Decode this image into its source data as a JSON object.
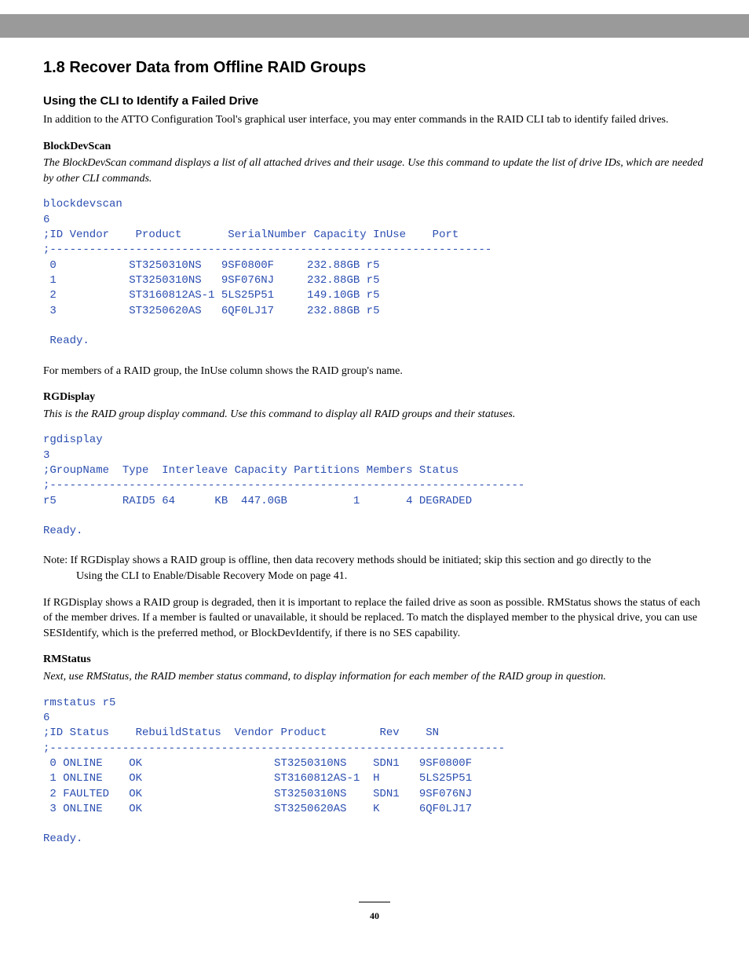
{
  "heading": "1.8 Recover Data from Offline RAID Groups",
  "subheading": "Using the CLI to Identify a Failed Drive",
  "intro": "In addition to the ATTO Configuration Tool's graphical user interface, you may enter commands in the RAID CLI tab to identify failed drives.",
  "blockdevscan": {
    "name": "BlockDevScan",
    "desc": "The BlockDevScan command displays a list of all attached drives and their usage. Use this command to update the list of drive IDs, which are needed by other CLI commands.",
    "cli": "blockdevscan\n6\n;ID Vendor    Product       SerialNumber Capacity InUse    Port\n;-------------------------------------------------------------------\n 0           ST3250310NS   9SF0800F     232.88GB r5\n 1           ST3250310NS   9SF076NJ     232.88GB r5\n 2           ST3160812AS-1 5LS25P51     149.10GB r5\n 3           ST3250620AS   6QF0LJ17     232.88GB r5\n\n Ready."
  },
  "para_after_bds": "For members of a RAID group, the InUse column shows the RAID group's name.",
  "rgdisplay": {
    "name": "RGDisplay",
    "desc": "This is the RAID group display command. Use this command to display all RAID groups and their statuses.",
    "cli": "rgdisplay\n3\n;GroupName  Type  Interleave Capacity Partitions Members Status\n;------------------------------------------------------------------------\nr5          RAID5 64      KB  447.0GB          1       4 DEGRADED\n\nReady."
  },
  "note_line1": "Note: If RGDisplay shows a RAID group is offline, then data recovery methods should be initiated; skip this section and go directly to the",
  "note_line2": "Using the CLI to Enable/Disable Recovery Mode on page 41.",
  "para_after_note": "If RGDisplay shows a RAID group is degraded, then it is important to replace the failed drive as soon as possible. RMStatus shows the status of each of the member drives. If a member is faulted or unavailable, it should be replaced. To match the displayed member to the physical drive, you can use SESIdentify, which is the preferred method, or BlockDevIdentify, if there is no SES capability.",
  "rmstatus": {
    "name": "RMStatus",
    "desc": "Next, use RMStatus, the RAID member status command, to display information for each member of the RAID group in question.",
    "cli": "rmstatus r5\n6\n;ID Status    RebuildStatus  Vendor Product        Rev    SN\n;---------------------------------------------------------------------\n 0 ONLINE    OK                    ST3250310NS    SDN1   9SF0800F\n 1 ONLINE    OK                    ST3160812AS-1  H      5LS25P51\n 2 FAULTED   OK                    ST3250310NS    SDN1   9SF076NJ\n 3 ONLINE    OK                    ST3250620AS    K      6QF0LJ17\n\nReady."
  },
  "page_number": "40"
}
